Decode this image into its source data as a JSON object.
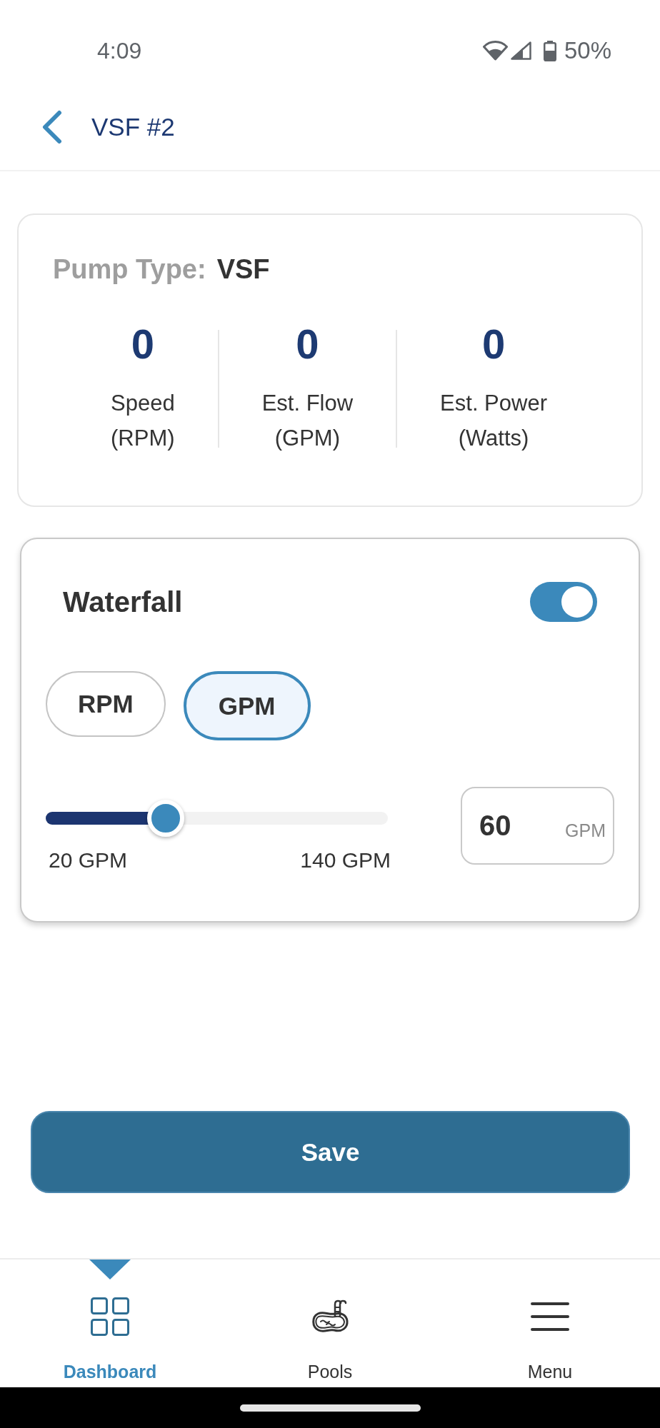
{
  "status_bar": {
    "time": "4:09",
    "battery": "50%"
  },
  "header": {
    "title": "VSF #2"
  },
  "pump_card": {
    "type_label": "Pump Type:",
    "type_value": "VSF",
    "stats": [
      {
        "value": "0",
        "label": "Speed",
        "unit": "(RPM)"
      },
      {
        "value": "0",
        "label": "Est. Flow",
        "unit": "(GPM)"
      },
      {
        "value": "0",
        "label": "Est. Power",
        "unit": "(Watts)"
      }
    ]
  },
  "mode_card": {
    "title": "Waterfall",
    "on": true,
    "units": [
      {
        "label": "RPM",
        "selected": false
      },
      {
        "label": "GPM",
        "selected": true
      }
    ],
    "slider": {
      "level": 0.35,
      "min_label": "20 GPM",
      "max_label": "140 GPM"
    },
    "input": {
      "value": "60",
      "unit": "GPM"
    }
  },
  "save_button": "Save",
  "bottom_nav": [
    {
      "kind": "dashboard",
      "label": "Dashboard",
      "selected": true
    },
    {
      "kind": "pools",
      "label": "Pools",
      "selected": false
    },
    {
      "kind": "menu",
      "label": "Menu",
      "selected": false
    }
  ]
}
